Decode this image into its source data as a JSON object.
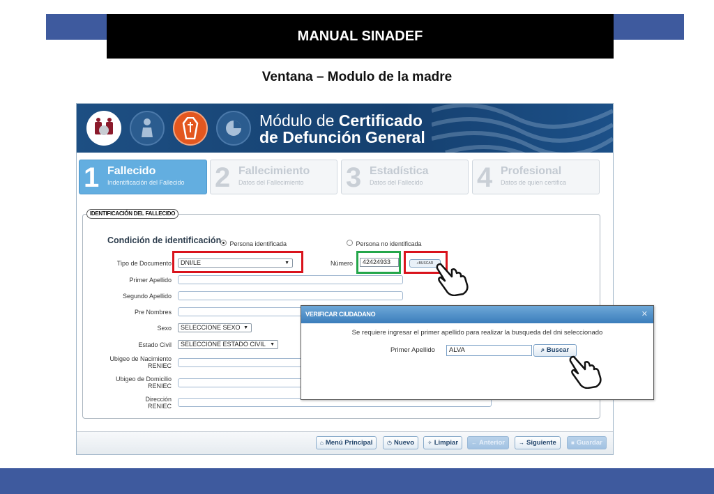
{
  "slide": {
    "header": "MANUAL SINADEF",
    "subtitle": "Ventana – Modulo de la madre"
  },
  "app": {
    "title_part1": "Módulo de ",
    "title_bold1": "Certificado",
    "title_bold2": "de Defunción General"
  },
  "steps": [
    {
      "num": "1",
      "title": "Fallecido",
      "sub": "Indentificación del Fallecido"
    },
    {
      "num": "2",
      "title": "Fallecimiento",
      "sub": "Datos del Fallecimiento"
    },
    {
      "num": "3",
      "title": "Estadística",
      "sub": "Datos del Fallecido"
    },
    {
      "num": "4",
      "title": "Profesional",
      "sub": "Datos de quien certifica"
    }
  ],
  "form": {
    "legend": "IDENTIFICACIÓN DEL FALLECIDO",
    "condicion_label": "Condición de identificación",
    "radio_identificada": "Persona identificada",
    "radio_no_identificada": "Persona no identificada",
    "tipo_documento_label": "Tipo de Documento",
    "tipo_documento_value": "DNI/LE",
    "numero_label": "Número",
    "numero_value": "42424933",
    "buscar_small": "BUSCAR",
    "primer_apellido_label": "Primer Apellido",
    "segundo_apellido_label": "Segundo Apellido",
    "pre_nombres_label": "Pre Nombres",
    "sexo_label": "Sexo",
    "sexo_value": "SELECCIONE SEXO",
    "estado_civil_label": "Estado Civil",
    "estado_civil_value": "SELECCIONE ESTADO CIVIL",
    "ubigeo_nac_label1": "Ubigeo de Nacimiento",
    "ubigeo_nac_label2": "RENIEC",
    "ubigeo_dom_label1": "Ubigeo de Domicilio",
    "ubigeo_dom_label2": "RENIEC",
    "direccion_label1": "Dirección",
    "direccion_label2": "RENIEC"
  },
  "toolbar": {
    "menu": "Menú Principal",
    "nuevo": "Nuevo",
    "limpiar": "Limpiar",
    "anterior": "Anterior",
    "siguiente": "Siguiente",
    "guardar": "Guardar"
  },
  "modal": {
    "title": "VERIFICAR CIUDADANO",
    "message": "Se requiere ingresar el primer apellido para realizar la busqueda del dni seleccionado",
    "label": "Primer Apellido",
    "value": "ALVA",
    "button": "Buscar"
  },
  "colors": {
    "band_blue": "#3e5a9e",
    "app_header": "#1d4f83",
    "step_active": "#63aee0",
    "highlight_red": "#d9131c",
    "highlight_green": "#23a64a"
  }
}
